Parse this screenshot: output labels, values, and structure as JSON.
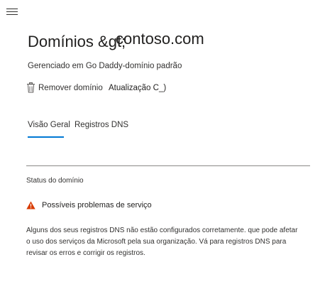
{
  "page": {
    "title_prefix": "Domínios &gt;",
    "domain_name": "contoso.com",
    "subtitle": "Gerenciado em Go Daddy-domínio padrão"
  },
  "actions": {
    "remove_label": "Remover domínio",
    "update_label": "Atualização C_)"
  },
  "tabs": [
    {
      "label": "Visão Geral",
      "active": true
    },
    {
      "label": "Registros DNS",
      "active": false
    }
  ],
  "status": {
    "section_label": "Status do domínio",
    "warning_text": "Possíveis problemas de serviço",
    "message_lines": [
      "Alguns dos seus registros DNS não estão configurados corretamente. que pode afetar",
      "o uso dos serviços da Microsoft pela sua organização. Vá para registros DNS para",
      "revisar os erros e corrigir os registros."
    ]
  },
  "colors": {
    "accent": "#0078d4",
    "warning": "#d83b01"
  },
  "icons": {
    "menu": "hamburger-menu-icon",
    "delete": "trash-icon",
    "warning": "warning-triangle-icon"
  }
}
